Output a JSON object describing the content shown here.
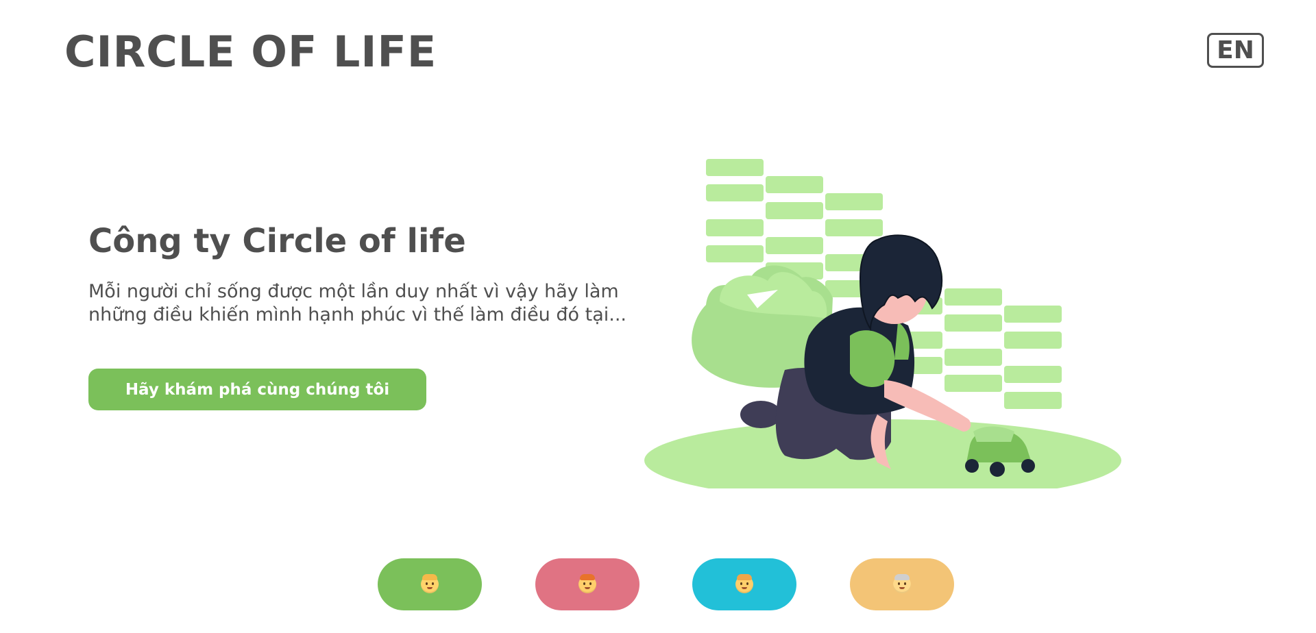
{
  "header": {
    "brand": "CIRCLE OF LIFE",
    "language_button": "EN"
  },
  "hero": {
    "title": "Công ty Circle of life",
    "description": "Mỗi người chỉ sống được một lần duy nhất vì vậy hãy làm những điều khiến mình hạnh phúc vì thế làm điều đó tại...",
    "cta_label": "Hãy khám phá cùng chúng tôi"
  },
  "life_stages": [
    {
      "icon": "baby-face-icon",
      "color": "#7bc05a"
    },
    {
      "icon": "child-face-icon",
      "color": "#e07383"
    },
    {
      "icon": "adult-face-icon",
      "color": "#22c0d8"
    },
    {
      "icon": "elder-face-icon",
      "color": "#f3c476"
    }
  ],
  "colors": {
    "text": "#4f4f4f",
    "accent_green": "#7bc05a",
    "light_green": "#b9eb9d"
  }
}
